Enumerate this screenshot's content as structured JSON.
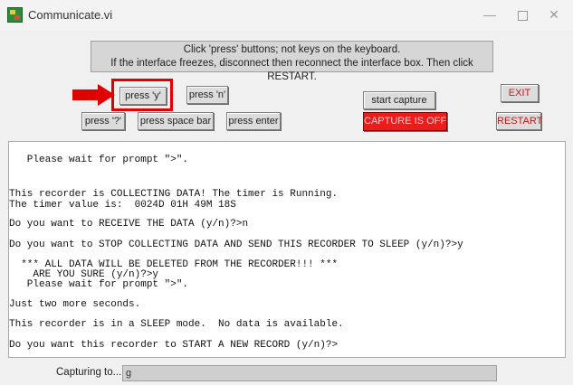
{
  "window": {
    "title": "Communicate.vi",
    "minimize_glyph": "—",
    "close_glyph": "✕",
    "icon": "labview-vi-icon"
  },
  "instructions": {
    "line1": "Click 'press' buttons; not keys on the keyboard.",
    "line2": "If the interface freezes, disconnect then reconnect the interface box. Then click RESTART."
  },
  "buttons": {
    "press_y": "press 'y'",
    "press_n": "press 'n'",
    "press_q": "press '?'",
    "press_space": "press space bar",
    "press_enter": "press enter",
    "start_capture": "start capture",
    "capture_status": "CAPTURE IS OFF",
    "exit": "EXIT",
    "restart": "RESTART"
  },
  "annotation": {
    "arrow_icon": "red-arrow-right-icon",
    "highlight_color": "#e00000"
  },
  "terminal": {
    "lines": [
      "   Please wait for prompt \">\".",
      "This recorder is COLLECTING DATA! The timer is Running.",
      "The timer value is:  0024D 01H 49M 18S",
      "Do you want to RECEIVE THE DATA (y/n)?>n",
      "Do you want to STOP COLLECTING DATA AND SEND THIS RECORDER TO SLEEP (y/n)?>y",
      "  *** ALL DATA WILL BE DELETED FROM THE RECORDER!!! ***",
      "    ARE YOU SURE (y/n)?>y",
      "   Please wait for prompt \">\".",
      "Just two more seconds.",
      "This recorder is in a SLEEP mode.  No data is available.",
      "Do you want this recorder to START A NEW RECORD (y/n)?>"
    ]
  },
  "capture": {
    "label": "Capturing to...",
    "value": "g"
  },
  "colors": {
    "capture_off_bg": "#ee1b1b",
    "exit_text": "#c81818"
  }
}
